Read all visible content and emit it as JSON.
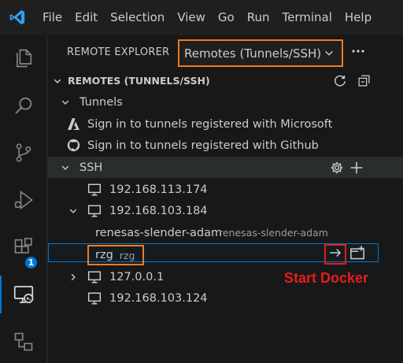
{
  "menu": [
    "File",
    "Edit",
    "Selection",
    "View",
    "Go",
    "Run",
    "Terminal",
    "Help"
  ],
  "activity_bar": {
    "items": [
      "explorer-icon",
      "search-icon",
      "source-control-icon",
      "run-debug-icon",
      "extensions-icon",
      "remote-explorer-icon",
      "remote-icon"
    ],
    "extensions_badge": "1"
  },
  "sidebar": {
    "title": "REMOTE EXPLORER",
    "dropdown": "Remotes (Tunnels/SSH)",
    "section_title": "REMOTES (TUNNELS/SSH)",
    "tunnels": {
      "label": "Tunnels",
      "items": [
        "Sign in to tunnels registered with Microsoft",
        "Sign in to tunnels registered with Github"
      ]
    },
    "ssh": {
      "label": "SSH",
      "hosts": [
        "192.168.113.174",
        "192.168.103.184",
        "127.0.0.1",
        "192.168.103.124"
      ],
      "folder": {
        "name": "renesas-slender-adam",
        "detail": "renesas-slender-adam"
      },
      "selected": {
        "name": "rzg",
        "detail": "rzg"
      }
    }
  },
  "annotation": "Start Docker",
  "colors": {
    "accent": "#0078d4",
    "highlight_orange": "#ef7b22",
    "highlight_red": "#e11d1d"
  }
}
